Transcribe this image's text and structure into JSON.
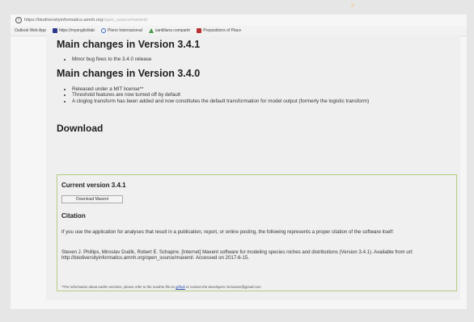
{
  "watermark": "e",
  "browser": {
    "url_host": "https://biodiversityinformatics.amnh.org",
    "url_path": "/open_source/maxent/",
    "bookmarks": [
      {
        "label": "Outlook Web App",
        "icon": "outlook-icon"
      },
      {
        "label": "https://myenglishlab",
        "icon": "pearson-icon"
      },
      {
        "label": "Pleno Internacional",
        "icon": "globe-icon"
      },
      {
        "label": "santillana compartir",
        "icon": "santillana-icon"
      },
      {
        "label": "Prepositions of Place",
        "icon": "bookmark-red-icon"
      }
    ]
  },
  "content": {
    "v341_heading": "Main changes in Version 3.4.1",
    "v341_items": [
      "Minor bug fixes to the 3.4.0 release"
    ],
    "v340_heading": "Main changes in Version 3.4.0",
    "v340_items": [
      "Released under a MIT license**",
      "Threshold features are now turned off by default",
      "A cloglog transform has been added and now constitutes the default transformation for model output (formerly the logistic transform)"
    ],
    "download_heading": "Download",
    "current_version_heading": "Current version 3.4.1",
    "download_button": "Download Maxent",
    "citation_heading": "Citation",
    "citation_intro": "If you use the application for analyses that result in a publication, report, or online posting, the following represents a proper citation of the software itself:",
    "citation_text": "Steven J. Phillips, Miroslav Dudík, Robert E. Schapire. [Internet] Maxent software for modeling species niches and distributions (Version 3.4.1). Available from url: http://biodiversityinformatics.amnh.org/open_source/maxent/. Accessed on 2017-6-15.",
    "footnote_pre": "**For information about earlier versions, please refer to the readme file on ",
    "footnote_link": "github",
    "footnote_post": " or contact the developers mrmaxent@gmail.com"
  }
}
